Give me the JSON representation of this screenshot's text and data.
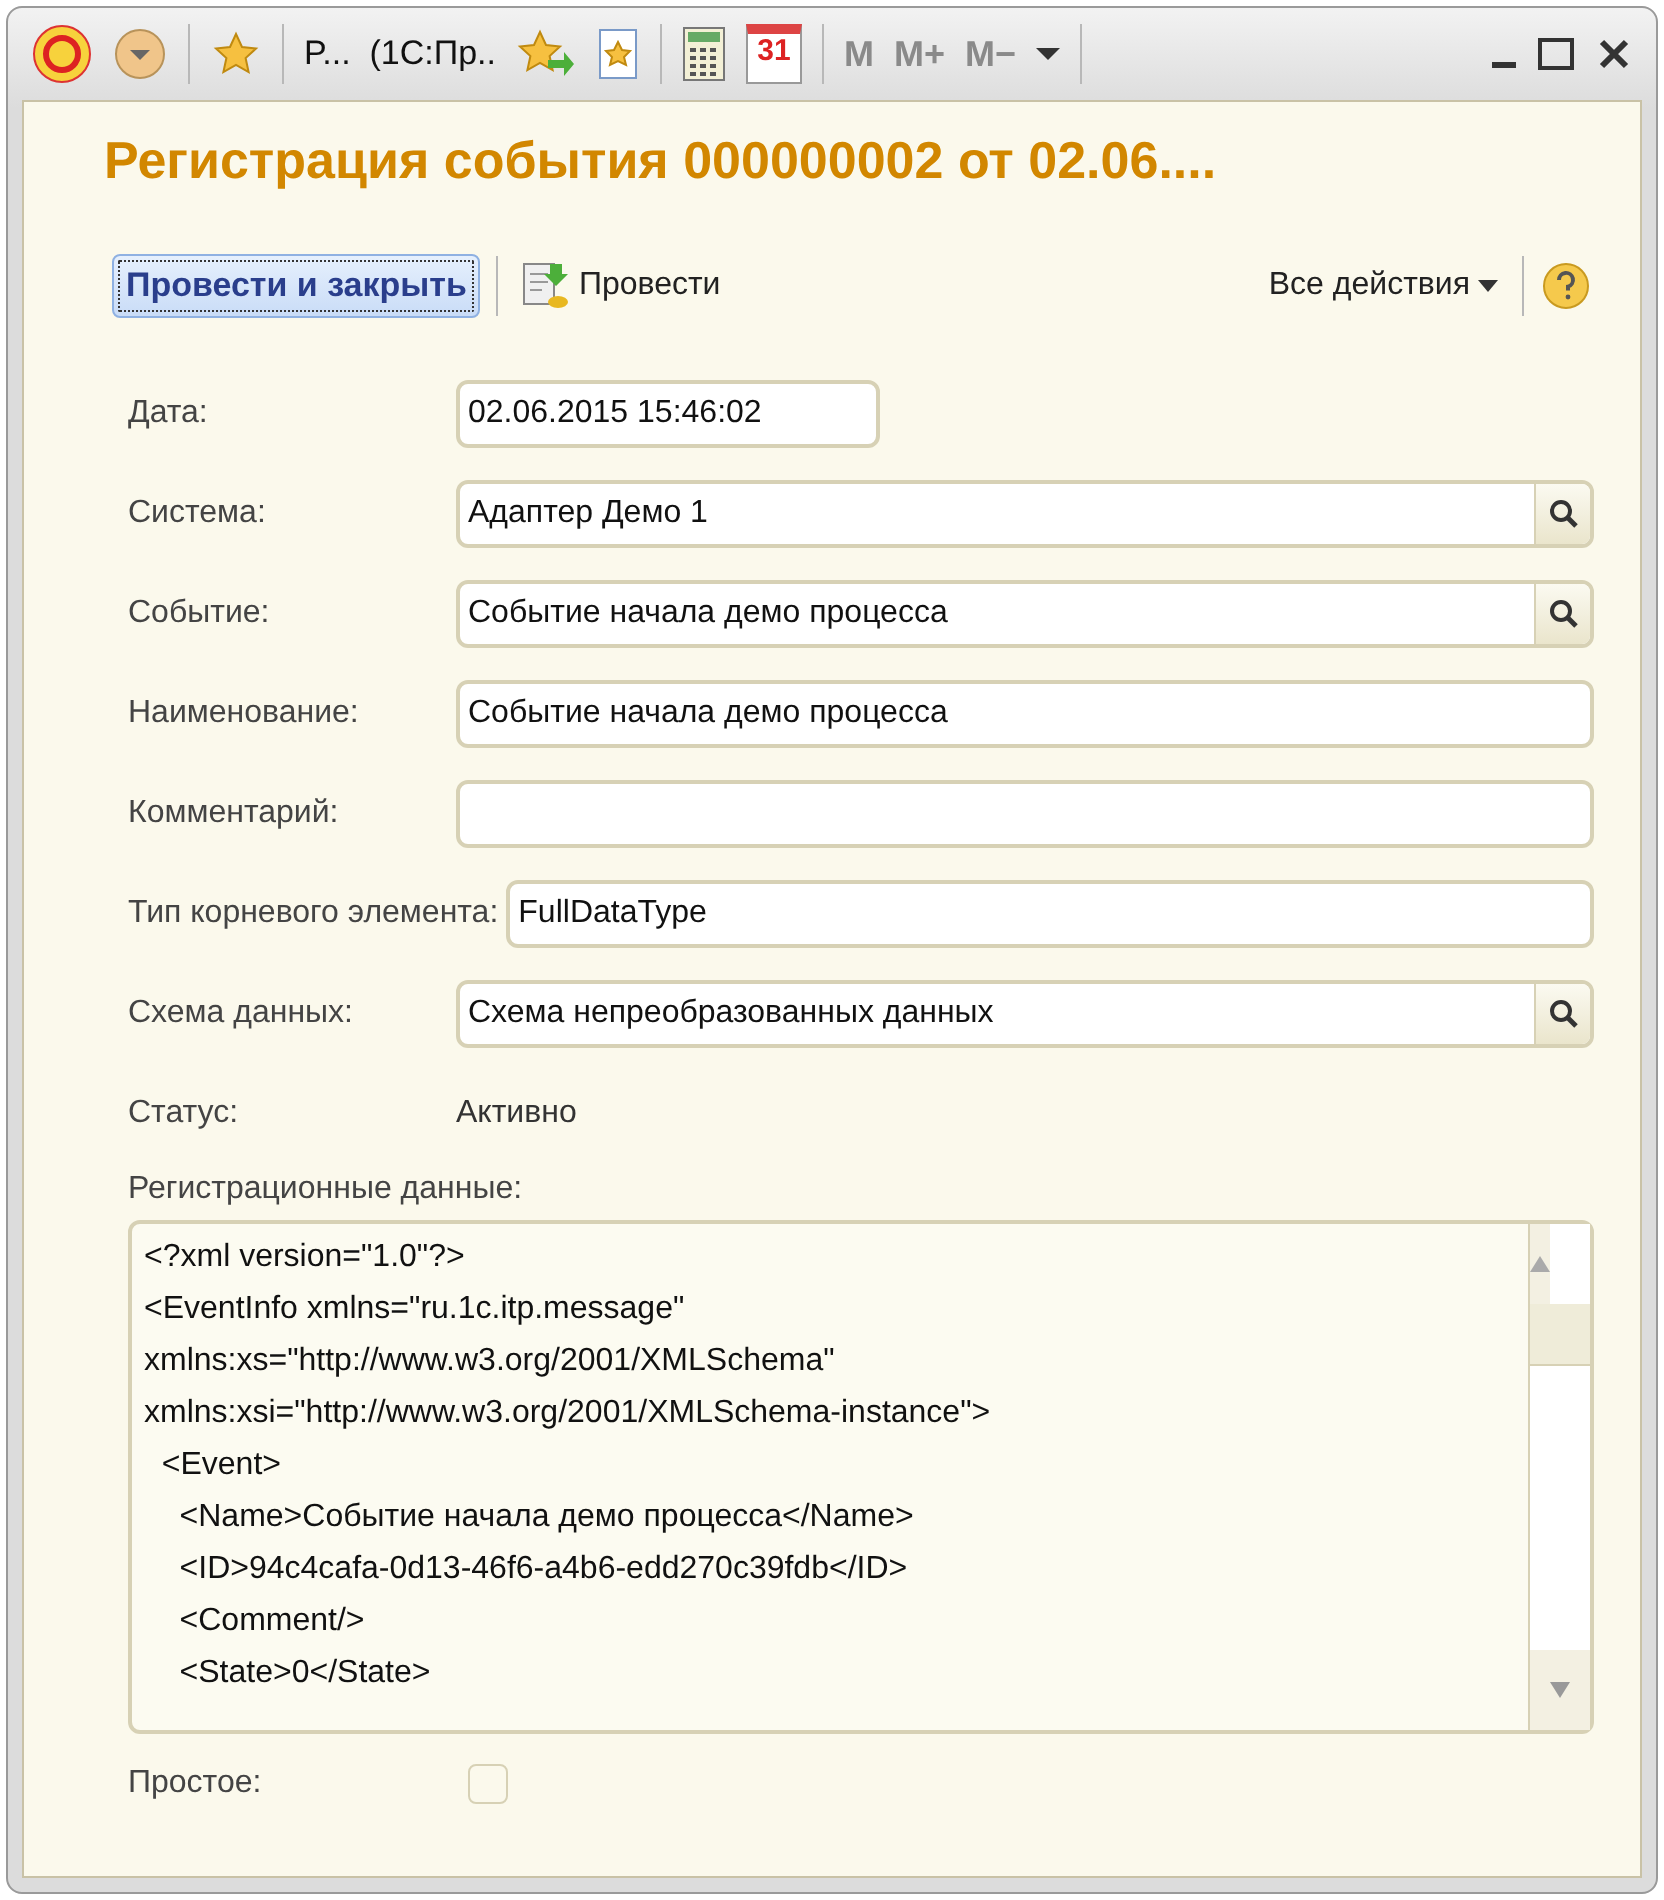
{
  "title_bar": {
    "title": "P...  (1С:Пр..",
    "calendar_day": "31",
    "memory_buttons": [
      "M",
      "M+",
      "M−"
    ]
  },
  "form": {
    "title": "Регистрация события 000000002 от 02.06....",
    "toolbar": {
      "primary": "Провести и закрыть",
      "secondary": "Провести",
      "all_actions": "Все действия"
    },
    "fields": [
      {
        "label": "Дата:",
        "value": "02.06.2015 15:46:02",
        "kind": "date"
      },
      {
        "label": "Система:",
        "value": "Адаптер Демо 1",
        "kind": "select"
      },
      {
        "label": "Событие:",
        "value": "Событие начала демо процесса",
        "kind": "select"
      },
      {
        "label": "Наименование:",
        "value": "Событие начала демо процесса",
        "kind": "text"
      },
      {
        "label": "Комментарий:",
        "kind": "text"
      },
      {
        "label": "Тип корневого элемента:",
        "value": "FullDataType",
        "kind": "text"
      },
      {
        "label": "Схема данных:",
        "value": "Схема непреобразованных данных",
        "kind": "select"
      }
    ],
    "status": {
      "label": "Статус:",
      "value": "Активно"
    },
    "registration": {
      "label": "Регистрационные данные:",
      "lines": [
        "<?xml version=\"1.0\"?>",
        "<EventInfo xmlns=\"ru.1c.itp.message\"",
        "xmlns:xs=\"http://www.w3.org/2001/XMLSchema\"",
        "xmlns:xsi=\"http://www.w3.org/2001/XMLSchema-instance\">",
        "  <Event>",
        "    <Name>Событие начала демо процесса</Name>",
        "    <ID>94c4cafa-0d13-46f6-a4b6-edd270c39fdb</ID>",
        "    <Comment/>",
        "    <State>0</State>"
      ]
    },
    "simple": {
      "label": "Простое:",
      "checked": false
    }
  }
}
